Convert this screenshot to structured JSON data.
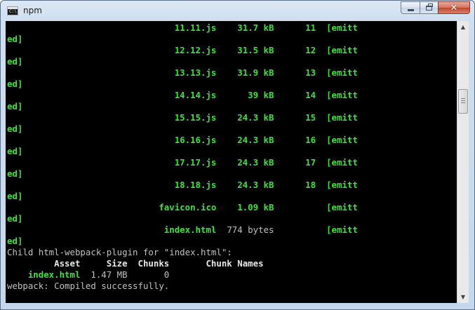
{
  "window": {
    "title": "npm",
    "icon": "console-icon",
    "buttons": {
      "minimize": "minimize-icon",
      "maximize": "maximize-icon",
      "close": "close-icon"
    }
  },
  "console": {
    "lines": [
      [
        {
          "t": "                                11.11.js    31.7 kB      11  ",
          "c": "g"
        },
        {
          "t": "[emitt",
          "c": "g"
        }
      ],
      [
        {
          "t": "ed]",
          "c": "g"
        }
      ],
      [
        {
          "t": "                                12.12.js    31.5 kB      12  ",
          "c": "g"
        },
        {
          "t": "[emitt",
          "c": "g"
        }
      ],
      [
        {
          "t": "ed]",
          "c": "g"
        }
      ],
      [
        {
          "t": "                                13.13.js    31.9 kB      13  ",
          "c": "g"
        },
        {
          "t": "[emitt",
          "c": "g"
        }
      ],
      [
        {
          "t": "ed]",
          "c": "g"
        }
      ],
      [
        {
          "t": "                                14.14.js      39 kB      14  ",
          "c": "g"
        },
        {
          "t": "[emitt",
          "c": "g"
        }
      ],
      [
        {
          "t": "ed]",
          "c": "g"
        }
      ],
      [
        {
          "t": "                                15.15.js    24.3 kB      15  ",
          "c": "g"
        },
        {
          "t": "[emitt",
          "c": "g"
        }
      ],
      [
        {
          "t": "ed]",
          "c": "g"
        }
      ],
      [
        {
          "t": "                                16.16.js    24.3 kB      16  ",
          "c": "g"
        },
        {
          "t": "[emitt",
          "c": "g"
        }
      ],
      [
        {
          "t": "ed]",
          "c": "g"
        }
      ],
      [
        {
          "t": "                                17.17.js    24.3 kB      17  ",
          "c": "g"
        },
        {
          "t": "[emitt",
          "c": "g"
        }
      ],
      [
        {
          "t": "ed]",
          "c": "g"
        }
      ],
      [
        {
          "t": "                                18.18.js    24.3 kB      18  ",
          "c": "g"
        },
        {
          "t": "[emitt",
          "c": "g"
        }
      ],
      [
        {
          "t": "ed]",
          "c": "g"
        }
      ],
      [
        {
          "t": "                             favicon.ico    1.09 kB          ",
          "c": "g"
        },
        {
          "t": "[emitt",
          "c": "g"
        }
      ],
      [
        {
          "t": "ed]",
          "c": "g"
        }
      ],
      [
        {
          "t": "                              index.html",
          "c": "g"
        },
        {
          "t": "  774 bytes          ",
          "c": "w"
        },
        {
          "t": "[emitt",
          "c": "g"
        }
      ],
      [
        {
          "t": "ed]",
          "c": "g"
        }
      ],
      [
        {
          "t": "Child html-webpack-plugin for \"index.html\":",
          "c": "w"
        }
      ],
      [
        {
          "t": "         Asset     Size  Chunks       Chunk Names",
          "c": "wb"
        }
      ],
      [
        {
          "t": "    index.html",
          "c": "g"
        },
        {
          "t": "  1.47 MB       0",
          "c": "w"
        }
      ],
      [
        {
          "t": "webpack: Compiled successfully.",
          "c": "w"
        }
      ]
    ]
  },
  "scrollbar": {
    "up": "scroll-up-arrow-icon",
    "down": "scroll-down-arrow-icon",
    "position": 0.25
  }
}
